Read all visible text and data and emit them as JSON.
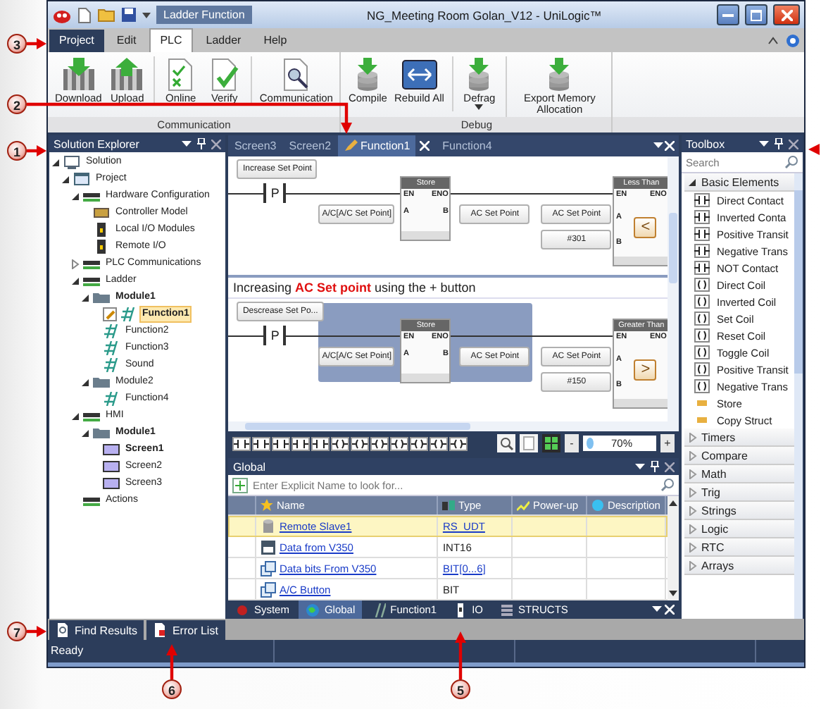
{
  "title_bar": {
    "context_tab": "Ladder Function",
    "title": "NG_Meeting Room Golan_V12 - UniLogic™"
  },
  "menu_tabs": [
    {
      "label": "Project",
      "kind": "app",
      "selected": false
    },
    {
      "label": "Edit",
      "kind": "tab",
      "selected": false
    },
    {
      "label": "PLC",
      "kind": "tab",
      "selected": true
    },
    {
      "label": "Ladder",
      "kind": "tab",
      "selected": false
    },
    {
      "label": "Help",
      "kind": "tab",
      "selected": false
    }
  ],
  "ribbon_groups": [
    {
      "label": "Communication",
      "buttons": [
        {
          "label": "Download",
          "kind": "download",
          "separator": false
        },
        {
          "label": "Upload",
          "kind": "upload",
          "separator": false
        },
        {
          "label": "Online",
          "kind": "online",
          "separator": true
        },
        {
          "label": "Verify",
          "kind": "verify",
          "separator": false
        },
        {
          "label": "Communication",
          "kind": "comm",
          "separator": true
        }
      ]
    },
    {
      "label": "Debug",
      "buttons": [
        {
          "label": "Compile",
          "kind": "compile",
          "separator": false
        },
        {
          "label": "Rebuild All",
          "kind": "rebuild",
          "separator": false
        },
        {
          "label": "Defrag",
          "kind": "defrag",
          "separator": true,
          "dropdown": true
        },
        {
          "label": "Export Memory Allocation",
          "kind": "export",
          "separator": true
        }
      ]
    }
  ],
  "solution_explorer": {
    "title": "Solution Explorer",
    "tree": [
      {
        "label": "Solution",
        "kind": "solution",
        "bold": false,
        "selected": false,
        "expanded": true,
        "children": [
          {
            "label": "Project",
            "kind": "project",
            "bold": false,
            "selected": false,
            "expanded": true,
            "children": [
              {
                "label": "Hardware Configuration",
                "kind": "tag",
                "bold": false,
                "selected": false,
                "expanded": true,
                "children": [
                  {
                    "label": "Controller Model",
                    "kind": "controller",
                    "bold": false,
                    "selected": false
                  },
                  {
                    "label": "Local I/O Modules",
                    "kind": "io",
                    "bold": false,
                    "selected": false
                  },
                  {
                    "label": "Remote I/O",
                    "kind": "io",
                    "bold": false,
                    "selected": false
                  }
                ]
              },
              {
                "label": "PLC Communications",
                "kind": "tag",
                "bold": false,
                "selected": false,
                "expanded": false
              },
              {
                "label": "Ladder",
                "kind": "tag",
                "bold": false,
                "selected": false,
                "expanded": true,
                "children": [
                  {
                    "label": "Module1",
                    "kind": "folder",
                    "bold": true,
                    "selected": false,
                    "expanded": true,
                    "children": [
                      {
                        "label": "Function1",
                        "kind": "function",
                        "bold": true,
                        "selected": true,
                        "editing": true
                      },
                      {
                        "label": "Function2",
                        "kind": "function",
                        "bold": false,
                        "selected": false,
                        "editing": false
                      },
                      {
                        "label": "Function3",
                        "kind": "function",
                        "bold": false,
                        "selected": false,
                        "editing": false
                      },
                      {
                        "label": "Sound",
                        "kind": "function",
                        "bold": false,
                        "selected": false,
                        "editing": false
                      }
                    ]
                  },
                  {
                    "label": "Module2",
                    "kind": "folder",
                    "bold": false,
                    "selected": false,
                    "expanded": true,
                    "children": [
                      {
                        "label": "Function4",
                        "kind": "function",
                        "bold": false,
                        "selected": false,
                        "editing": false
                      }
                    ]
                  }
                ]
              },
              {
                "label": "HMI",
                "kind": "tag",
                "bold": false,
                "selected": false,
                "expanded": true,
                "children": [
                  {
                    "label": "Module1",
                    "kind": "folder",
                    "bold": true,
                    "selected": false,
                    "expanded": true,
                    "children": [
                      {
                        "label": "Screen1",
                        "kind": "screen",
                        "bold": true,
                        "selected": false
                      },
                      {
                        "label": "Screen2",
                        "kind": "screen",
                        "bold": false,
                        "selected": false
                      },
                      {
                        "label": "Screen3",
                        "kind": "screen",
                        "bold": false,
                        "selected": false
                      }
                    ]
                  }
                ]
              },
              {
                "label": "Actions",
                "kind": "tag",
                "bold": false,
                "selected": false
              }
            ]
          }
        ]
      }
    ]
  },
  "document_tabs": [
    {
      "label": "Screen3",
      "selected": false,
      "closable": false
    },
    {
      "label": "Screen2",
      "selected": false,
      "closable": false
    },
    {
      "label": "Function1",
      "selected": true,
      "closable": true
    },
    {
      "label": "Function4",
      "selected": false,
      "closable": false
    }
  ],
  "ladder": {
    "rungs": [
      {
        "title": "Increase Set Point",
        "contact": "P",
        "selected": false,
        "store": {
          "title": "Store",
          "pins": [
            "EN",
            "ENO",
            "A",
            "B"
          ]
        },
        "store_in": "A/C[A/C Set Point]",
        "store_out": "AC Set Point",
        "compare": {
          "title": "Less Than",
          "pins": [
            "EN",
            "ENO",
            "A",
            "B"
          ],
          "symbol": "<"
        },
        "compare_a": "AC Set Point",
        "compare_b": "#301"
      },
      {
        "comment": "Increasing **AC Set point** using the + button",
        "title": "Descrease Set Po...",
        "contact": "P",
        "selected": true,
        "store": {
          "title": "Store",
          "pins": [
            "EN",
            "ENO",
            "A",
            "B"
          ]
        },
        "store_in": "A/C[A/C Set Point]",
        "store_out": "AC Set Point",
        "compare": {
          "title": "Greater Than",
          "pins": [
            "EN",
            "ENO",
            "A",
            "B"
          ],
          "symbol": ">"
        },
        "compare_a": "AC Set Point",
        "compare_b": "#150"
      }
    ],
    "zoom": {
      "minus": "-",
      "value": "70%",
      "plus": "+"
    }
  },
  "global_panel": {
    "title": "Global",
    "search_placeholder": "Enter Explicit Name to look for...",
    "columns": [
      "Name",
      "Type",
      "Power-up",
      "Description"
    ],
    "rows": [
      {
        "name": "Remote Slave1",
        "kind": "slave",
        "type": "RS_UDT",
        "type_link": true,
        "selected": true
      },
      {
        "name": "Data from V350",
        "kind": "data",
        "type": "INT16",
        "type_link": false,
        "selected": false
      },
      {
        "name": "Data bits From V350",
        "kind": "bits",
        "type": "BIT[0...6]",
        "type_link": true,
        "selected": false
      },
      {
        "name": "A/C Button",
        "kind": "bits",
        "type": "BIT",
        "type_link": false,
        "selected": false
      }
    ],
    "tabs": [
      {
        "label": "System",
        "kind": "system",
        "selected": false
      },
      {
        "label": "Global",
        "kind": "global",
        "selected": true
      },
      {
        "label": "Function1",
        "kind": "function",
        "selected": false
      },
      {
        "label": "IO",
        "kind": "io",
        "selected": false
      },
      {
        "label": "STRUCTS",
        "kind": "structs",
        "selected": false
      }
    ]
  },
  "toolbox": {
    "title": "Toolbox",
    "search_placeholder": "Search",
    "sections": [
      {
        "label": "Basic Elements",
        "expanded": true,
        "items": [
          {
            "label": "Direct Contact",
            "kind": "contact"
          },
          {
            "label": "Inverted Conta",
            "kind": "contact"
          },
          {
            "label": "Positive Transit",
            "kind": "contact"
          },
          {
            "label": "Negative Trans",
            "kind": "contact"
          },
          {
            "label": "NOT Contact",
            "kind": "contact"
          },
          {
            "label": "Direct Coil",
            "kind": "coil"
          },
          {
            "label": "Inverted Coil",
            "kind": "coil"
          },
          {
            "label": "Set Coil",
            "kind": "coil"
          },
          {
            "label": "Reset Coil",
            "kind": "coil"
          },
          {
            "label": "Toggle Coil",
            "kind": "coil"
          },
          {
            "label": "Positive Transit",
            "kind": "coil"
          },
          {
            "label": "Negative Trans",
            "kind": "coil"
          },
          {
            "label": "Store",
            "kind": "store"
          },
          {
            "label": "Copy Struct",
            "kind": "store"
          }
        ]
      },
      {
        "label": "Timers",
        "expanded": false
      },
      {
        "label": "Compare",
        "expanded": false
      },
      {
        "label": "Math",
        "expanded": false
      },
      {
        "label": "Trig",
        "expanded": false
      },
      {
        "label": "Strings",
        "expanded": false
      },
      {
        "label": "Logic",
        "expanded": false
      },
      {
        "label": "RTC",
        "expanded": false
      },
      {
        "label": "Arrays",
        "expanded": false
      }
    ]
  },
  "dock_tabs": [
    {
      "label": "Find Results",
      "kind": "find"
    },
    {
      "label": "Error List",
      "kind": "errors"
    }
  ],
  "status_bar": {
    "text": "Ready"
  },
  "callouts": [
    {
      "number": "3"
    },
    {
      "number": "2"
    },
    {
      "number": "1"
    },
    {
      "number": "7"
    },
    {
      "number": "6"
    },
    {
      "number": "5"
    }
  ]
}
